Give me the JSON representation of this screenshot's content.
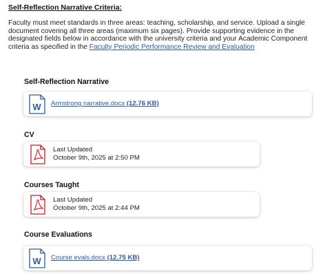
{
  "criteria": {
    "heading": "Self-Reflection Narrative Criteria:",
    "body": "Faculty must meet standards in three areas: teaching, scholarship, and service. Upload a single document covering all three areas (maximum six pages). Provide supporting evidence in the designated fields below in accordance with the university criteria and your Academic Component criteria as specified in the ",
    "link_text": "Faculty Periodic Performance Review and Evaluation"
  },
  "sections": {
    "narrative": {
      "title": "Self-Reflection Narrative",
      "file_name": "Armstrong narrative.docx",
      "file_size": "(12.76 KB)",
      "icon": "word-doc-icon"
    },
    "cv": {
      "title": "CV",
      "updated_label": "Last Updated",
      "updated_date": "October 9th, 2025 at 2:50 PM",
      "icon": "pdf-icon"
    },
    "courses": {
      "title": "Courses Taught",
      "updated_label": "Last Updated",
      "updated_date": "October 9th, 2025 at 2:44 PM",
      "icon": "pdf-icon"
    },
    "evaluations": {
      "title": "Course Evaluations",
      "file_name": "Course evals.docx",
      "file_size": "(12.75 KB)",
      "icon": "word-doc-icon"
    }
  },
  "colors": {
    "link": "#2b5aa6",
    "word": "#2b5aa6",
    "pdf": "#c8191e"
  }
}
